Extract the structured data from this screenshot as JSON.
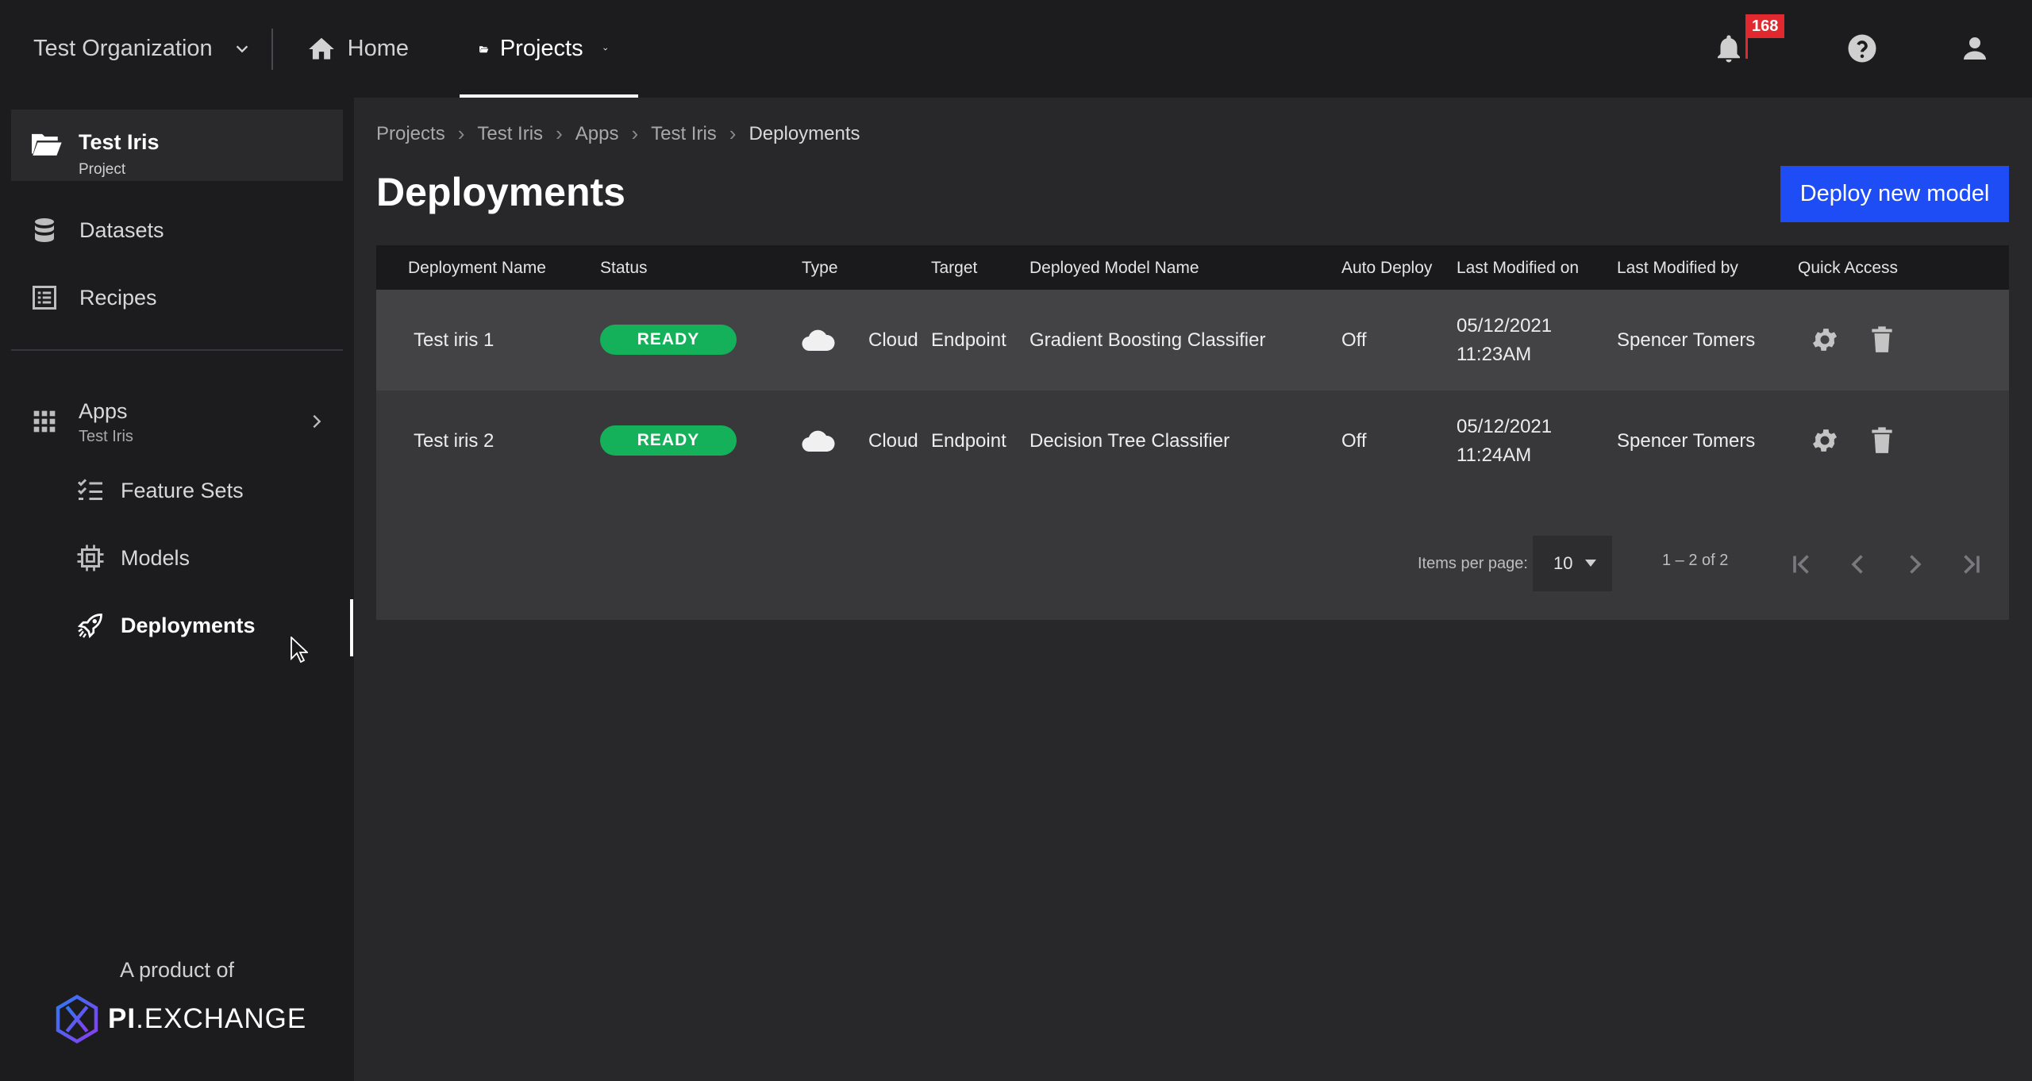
{
  "topbar": {
    "org_name": "Test Organization",
    "home_label": "Home",
    "projects_label": "Projects",
    "notification_count": "168"
  },
  "sidebar": {
    "project": {
      "name": "Test Iris",
      "subtitle": "Project"
    },
    "items": [
      {
        "label": "Datasets",
        "icon": "database-icon"
      },
      {
        "label": "Recipes",
        "icon": "list-icon"
      }
    ],
    "apps": {
      "label": "Apps",
      "subtitle": "Test Iris"
    },
    "sub_items": [
      {
        "label": "Feature Sets",
        "icon": "checklist-icon"
      },
      {
        "label": "Models",
        "icon": "chip-icon"
      },
      {
        "label": "Deployments",
        "icon": "rocket-icon",
        "active": true
      }
    ],
    "footer": {
      "text": "A product of",
      "logo_bold": "PI",
      "logo_rest": ".EXCHANGE"
    }
  },
  "breadcrumb": [
    "Projects",
    "Test Iris",
    "Apps",
    "Test Iris",
    "Deployments"
  ],
  "page": {
    "title": "Deployments",
    "deploy_button": "Deploy new model"
  },
  "table": {
    "columns": [
      "Deployment Name",
      "Status",
      "Type",
      "Target",
      "Deployed Model Name",
      "Auto Deploy",
      "Last Modified on",
      "Last Modified by",
      "Quick Access"
    ],
    "rows": [
      {
        "name": "Test iris 1",
        "status": "READY",
        "type": "Cloud",
        "target": "Endpoint",
        "model": "Gradient Boosting Classifier",
        "auto_deploy": "Off",
        "date": "05/12/2021",
        "time": "11:23AM",
        "modified_by": "Spencer Tomers"
      },
      {
        "name": "Test iris 2",
        "status": "READY",
        "type": "Cloud",
        "target": "Endpoint",
        "model": "Decision Tree Classifier",
        "auto_deploy": "Off",
        "date": "05/12/2021",
        "time": "11:24AM",
        "modified_by": "Spencer Tomers"
      }
    ],
    "pagination": {
      "items_per_page_label": "Items per page:",
      "items_per_page": "10",
      "range": "1 – 2 of 2"
    }
  },
  "colors": {
    "accent": "#1e4cf5",
    "ready": "#14b05a",
    "badge": "#e0282e"
  }
}
